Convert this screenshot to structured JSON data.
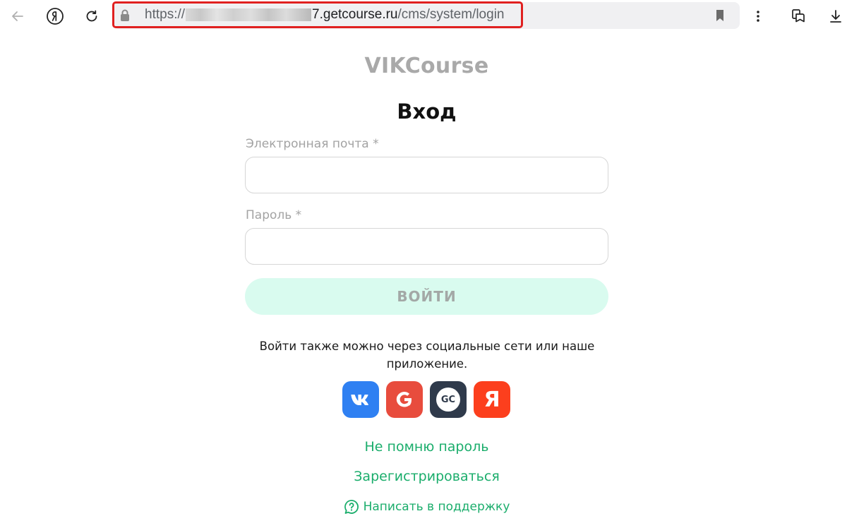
{
  "browser": {
    "url_prefix": "https://",
    "url_host": "7.getcourse.ru",
    "url_path": "/cms/system/login",
    "icons": [
      "back-icon",
      "yandex-icon",
      "reload-icon",
      "lock-icon",
      "bookmark-icon",
      "more-icon",
      "collections-icon",
      "download-icon"
    ]
  },
  "page": {
    "brand": "VIKCourse",
    "title": "Вход",
    "email_label": "Электронная почта *",
    "email_value": "",
    "password_label": "Пароль *",
    "password_value": "",
    "login_button": "ВОЙТИ",
    "social_text": "Войти также можно через социальные сети или наше приложение.",
    "social": {
      "vk": "vk",
      "gc": "GC",
      "ya": "Я"
    },
    "forgot_link": "Не помню пароль",
    "register_link": "Зарегистрироваться",
    "support_link": "Написать в поддержку"
  },
  "colors": {
    "accent": "#1aad6b",
    "login_button_bg": "#d9fbef",
    "highlight": "#e02020"
  }
}
